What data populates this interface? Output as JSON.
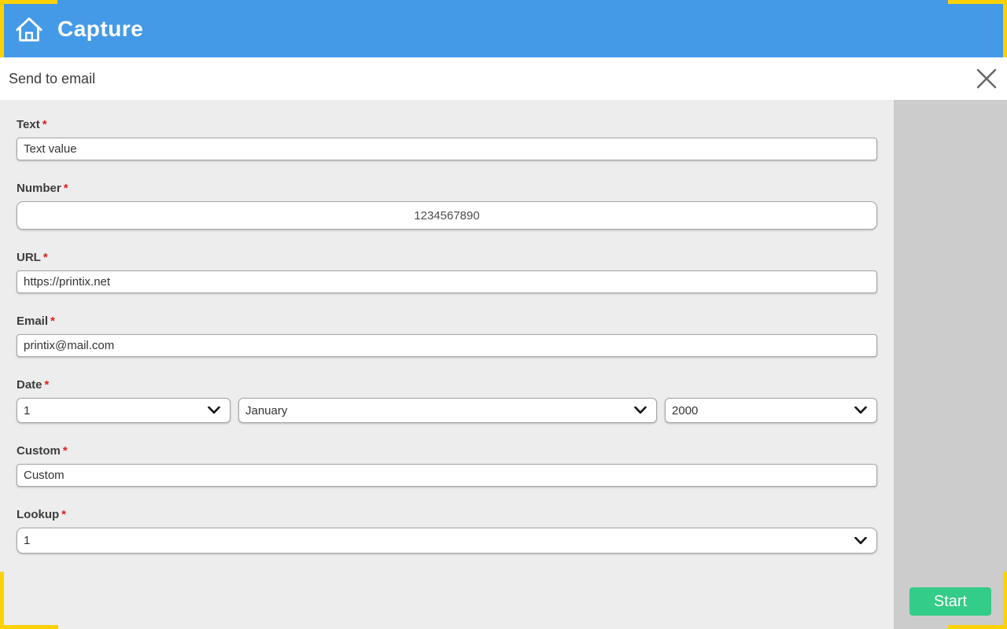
{
  "theme": {
    "header_blue": "#459ae8",
    "accent_yellow": "#ffd103",
    "form_bg": "#ededed",
    "sidebar_bg": "#cccccc",
    "button_green": "#33cc88",
    "asterisk_red": "#e02020"
  },
  "header": {
    "app_title": "Capture",
    "home_icon": "home-icon"
  },
  "titlebar": {
    "title": "Send to email",
    "close_icon": "close-icon"
  },
  "form": {
    "text": {
      "label": "Text",
      "required": "*",
      "value": "Text value"
    },
    "number": {
      "label": "Number",
      "required": "*",
      "value": "1234567890"
    },
    "url": {
      "label": "URL",
      "required": "*",
      "value": "https://printix.net"
    },
    "email": {
      "label": "Email",
      "required": "*",
      "value": "printix@mail.com"
    },
    "date": {
      "label": "Date",
      "required": "*",
      "day": "1",
      "month": "January",
      "year": "2000",
      "chevron_icon": "chevron-down-icon"
    },
    "custom": {
      "label": "Custom",
      "required": "*",
      "value": "Custom"
    },
    "lookup": {
      "label": "Lookup",
      "required": "*",
      "value": "1",
      "chevron_icon": "chevron-down-icon"
    }
  },
  "sidebar": {
    "start_label": "Start"
  }
}
